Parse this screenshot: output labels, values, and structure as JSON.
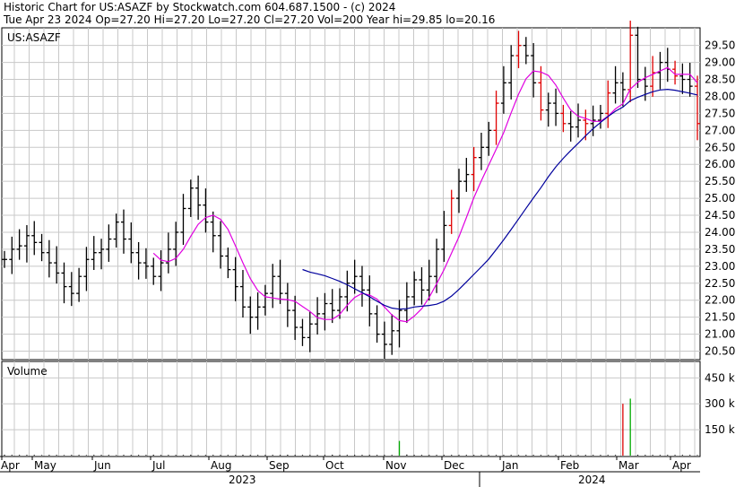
{
  "header": {
    "line1": "Historic Chart for US:ASAZF by Stockwatch.com 604.687.1500 - (c) 2024",
    "line2": "Tue Apr 23 2024  Op=27.20  Hi=27.20  Lo=27.20  Cl=27.20  Vol=200  Year hi=29.85  lo=20.16"
  },
  "colors": {
    "bar": "#000000",
    "red_bar": "#e00000",
    "ma_short": "#e000e0",
    "ma_long": "#00009c",
    "vol_green": "#00aa00",
    "vol_red": "#dd0000",
    "grid": "#c8c8c8"
  },
  "chart_data": [
    {
      "type": "ohlc",
      "label": "US:ASAZF",
      "ylim": [
        20.16,
        29.85
      ],
      "y_ticks": [
        "20.50",
        "21.00",
        "21.50",
        "22.00",
        "22.50",
        "23.00",
        "23.50",
        "24.00",
        "24.50",
        "25.00",
        "25.50",
        "26.00",
        "26.50",
        "27.00",
        "27.50",
        "28.00",
        "28.50",
        "29.00",
        "29.50"
      ],
      "x_ticks": [
        "Apr",
        "May",
        "Jun",
        "Jul",
        "Aug",
        "Sep",
        "Oct",
        "Nov",
        "Dec",
        "Jan",
        "Feb",
        "Mar",
        "Apr"
      ],
      "years": [
        "2023",
        "2024"
      ],
      "grid": true,
      "close": [
        23.2,
        23.5,
        23.6,
        23.9,
        23.7,
        23.4,
        23.1,
        22.8,
        22.4,
        22.2,
        22.7,
        23.2,
        23.4,
        23.5,
        23.8,
        24.3,
        23.8,
        23.4,
        23.1,
        23.0,
        22.7,
        23.1,
        23.5,
        24.0,
        24.7,
        25.3,
        24.8,
        24.3,
        23.9,
        23.3,
        22.9,
        22.4,
        21.8,
        21.5,
        21.8,
        22.2,
        22.7,
        22.2,
        21.7,
        21.2,
        20.9,
        21.3,
        21.6,
        21.9,
        21.7,
        22.1,
        22.5,
        22.7,
        22.3,
        21.6,
        21.0,
        20.7,
        21.1,
        21.7,
        22.1,
        22.6,
        22.3,
        22.7,
        23.5,
        24.2,
        25.0,
        25.5,
        25.7,
        26.2,
        26.5,
        27.0,
        27.8,
        28.4,
        29.2,
        29.5,
        29.2,
        28.4,
        27.6,
        27.8,
        27.5,
        27.2,
        27.1,
        27.3,
        27.2,
        27.3,
        27.5,
        28.1,
        28.4,
        28.2,
        29.8,
        28.5,
        28.3,
        28.7,
        29.0,
        28.8,
        28.6,
        28.5,
        28.3,
        27.2
      ],
      "ma_short_start_index": 20,
      "ma_long_start_index": 40
    },
    {
      "type": "bar",
      "label": "Volume",
      "y_ticks": [
        "150 k",
        "300 k",
        "450 k"
      ],
      "ylim": [
        0,
        540
      ],
      "values": [
        5,
        4,
        4,
        4,
        4,
        3,
        4,
        4,
        3,
        4,
        4,
        3,
        4,
        4,
        4,
        3,
        4,
        4,
        4,
        4,
        5,
        4,
        4,
        4,
        4,
        5,
        3,
        4,
        4,
        4,
        4,
        4,
        5,
        4,
        4,
        4,
        4,
        4,
        5,
        4,
        4,
        4,
        4,
        4,
        5,
        4,
        4,
        4,
        4,
        4,
        4,
        4,
        4,
        85,
        6,
        4,
        4,
        4,
        4,
        4,
        4,
        4,
        4,
        4,
        4,
        4,
        4,
        4,
        4,
        4,
        4,
        4,
        4,
        4,
        4,
        4,
        4,
        4,
        4,
        4,
        4,
        4,
        4,
        300,
        330,
        5,
        4,
        4,
        4,
        4,
        4,
        4,
        4,
        3
      ],
      "colors_by_index": {
        "53": "green",
        "83": "red",
        "84": "green"
      }
    }
  ]
}
